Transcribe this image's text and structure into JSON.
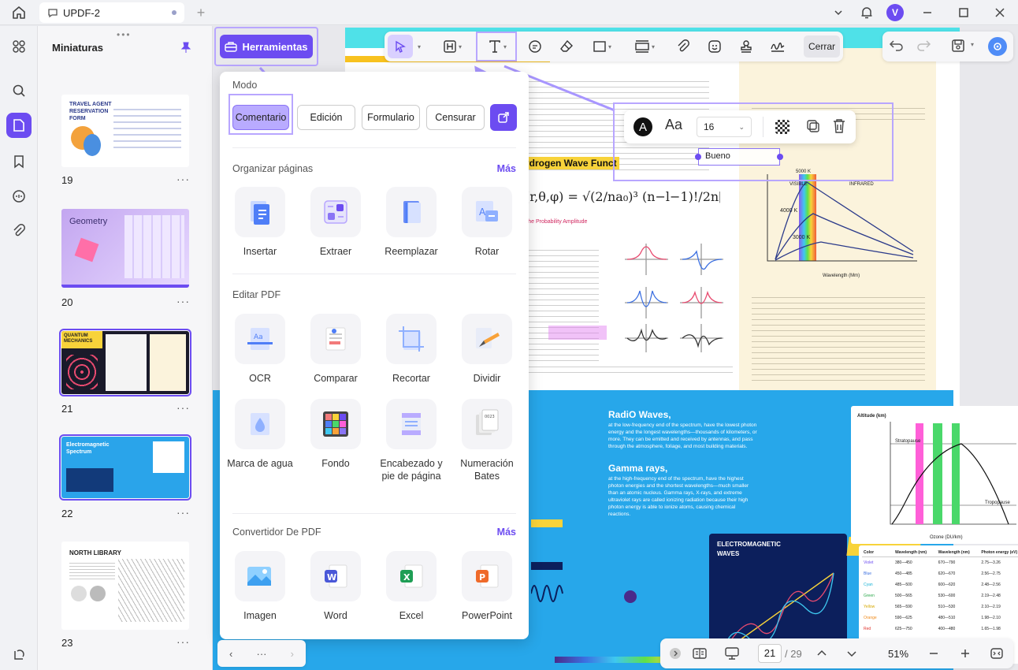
{
  "window": {
    "tab_title": "UPDF-2",
    "avatar_letter": "V"
  },
  "thumbnails": {
    "title": "Miniaturas",
    "pages": [
      {
        "num": "19",
        "label": "TRAVEL AGENT RESERVATION FORM"
      },
      {
        "num": "20",
        "label": "Geometry"
      },
      {
        "num": "21",
        "label": "QUANTUM MECHANICS"
      },
      {
        "num": "22",
        "label": "Electromagnetic Spectrum"
      },
      {
        "num": "23",
        "label": "NORTH LIBRARY"
      }
    ]
  },
  "toolbar": {
    "tools_label": "Herramientas",
    "close_label": "Cerrar"
  },
  "text_props": {
    "font_size": "16",
    "textbox_value": "Bueno"
  },
  "panel": {
    "mode": {
      "title": "Modo",
      "options": [
        "Comentario",
        "Edición",
        "Formulario",
        "Censurar"
      ]
    },
    "organize": {
      "title": "Organizar páginas",
      "more": "Más",
      "items": [
        "Insertar",
        "Extraer",
        "Reemplazar",
        "Rotar"
      ]
    },
    "edit": {
      "title": "Editar PDF",
      "row1": [
        "OCR",
        "Comparar",
        "Recortar",
        "Dividir"
      ],
      "row2": [
        "Marca de agua",
        "Fondo",
        "Encabezado y pie de página",
        "Numeración Bates"
      ]
    },
    "convert": {
      "title": "Convertidor De PDF",
      "more": "Más",
      "items": [
        "Imagen",
        "Word",
        "Excel",
        "PowerPoint"
      ]
    }
  },
  "document": {
    "p1_heading": "ydrogen Wave Funct",
    "p1_right_labels": {
      "visible": "VISIBLE",
      "infrared": "INFRARED",
      "k4000": "4000 K",
      "k3000": "3000 K",
      "k5000": "5000 K",
      "xlabel": "Wavelength (Mm)"
    },
    "p2_radio_title": "RadiO Waves,",
    "p2_radio_text": "at the low-frequency end of the spectrum, have the lowest photon energy and the longest wavelengths—thousands of kilometers, or more. They can be emitted and received by antennas, and pass through the atmosphere, foliage, and most building materials.",
    "p2_gamma_title": "Gamma rays,",
    "p2_gamma_text": "at the high-frequency end of the spectrum, have the highest photon energies and the shortest wavelengths—much smaller than an atomic nucleus. Gamma rays, X-rays, and extreme ultraviolet rays are called ionizing radiation because their high photon energy is able to ionize atoms, causing chemical reactions.",
    "p2_em_title": "ELECTROMAGNETIC WAVES",
    "p2_chart": {
      "ylabel": "Altitude (km)",
      "xlabel": "Ozone (DU/km)",
      "stratopause": "Stratopause",
      "tropopause": "Tropopause"
    },
    "p2_table_headers": [
      "Color",
      "Wavelength (nm)",
      "Wavelength (nm)",
      "Photon energy (eV)"
    ],
    "p2_table_rows": [
      [
        "Violet",
        "380—450",
        "670—790",
        "2.75—3.26"
      ],
      [
        "Blue",
        "450—485",
        "620—670",
        "2.56—2.75"
      ],
      [
        "Cyan",
        "485—500",
        "600—620",
        "2.48—2.56"
      ],
      [
        "Green",
        "500—565",
        "530—600",
        "2.19—2.48"
      ],
      [
        "Yellow",
        "565—590",
        "510—530",
        "2.10—2.19"
      ],
      [
        "Orange",
        "590—625",
        "480—510",
        "1.98—2.10"
      ],
      [
        "Red",
        "625—750",
        "400—480",
        "1.65—1.98"
      ]
    ]
  },
  "bottom": {
    "page_current": "21",
    "page_total": "/ 29",
    "zoom": "51%"
  },
  "colors": {
    "accent": "#6c4cf1",
    "highlight": "#b8a6ff"
  }
}
